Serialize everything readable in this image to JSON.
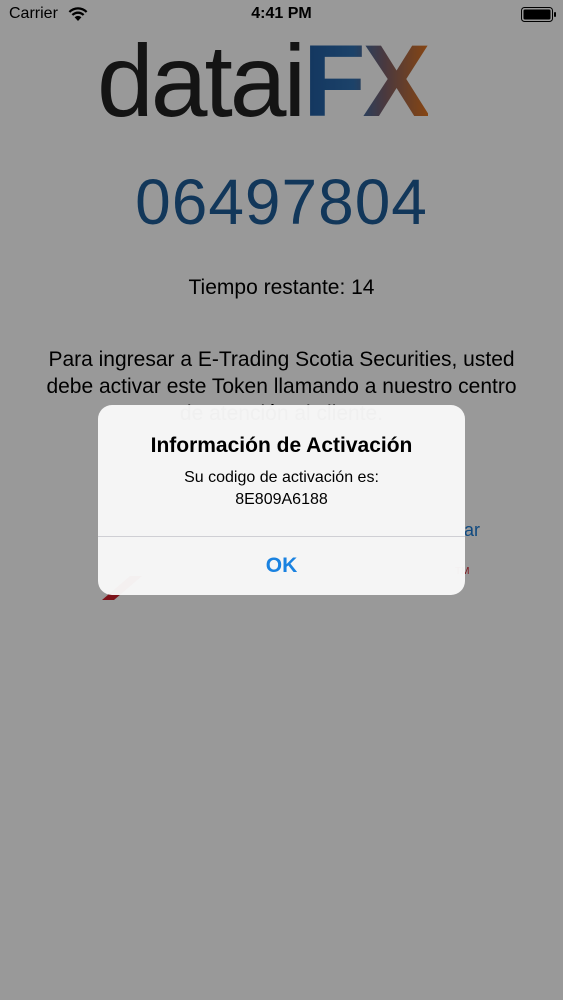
{
  "status_bar": {
    "carrier": "Carrier",
    "time": "4:41 PM"
  },
  "logo": {
    "part1": "datai",
    "part2": "FX"
  },
  "token": {
    "code": "06497804",
    "time_remaining": "Tiempo restante: 14",
    "instructions": "Para ingresar a E-Trading Scotia Securities, usted debe activar este Token llamando a nuestro centro de atención al cliente.",
    "link_fragment": "ar",
    "tm": "TM"
  },
  "alert": {
    "title": "Información de Activación",
    "message": "Su codigo de activación es:",
    "code": "8E809A6188",
    "button_label": "OK"
  },
  "colors": {
    "token": "#1f5c97",
    "accent": "#1a82e0",
    "brand_red": "#d11f2a"
  }
}
